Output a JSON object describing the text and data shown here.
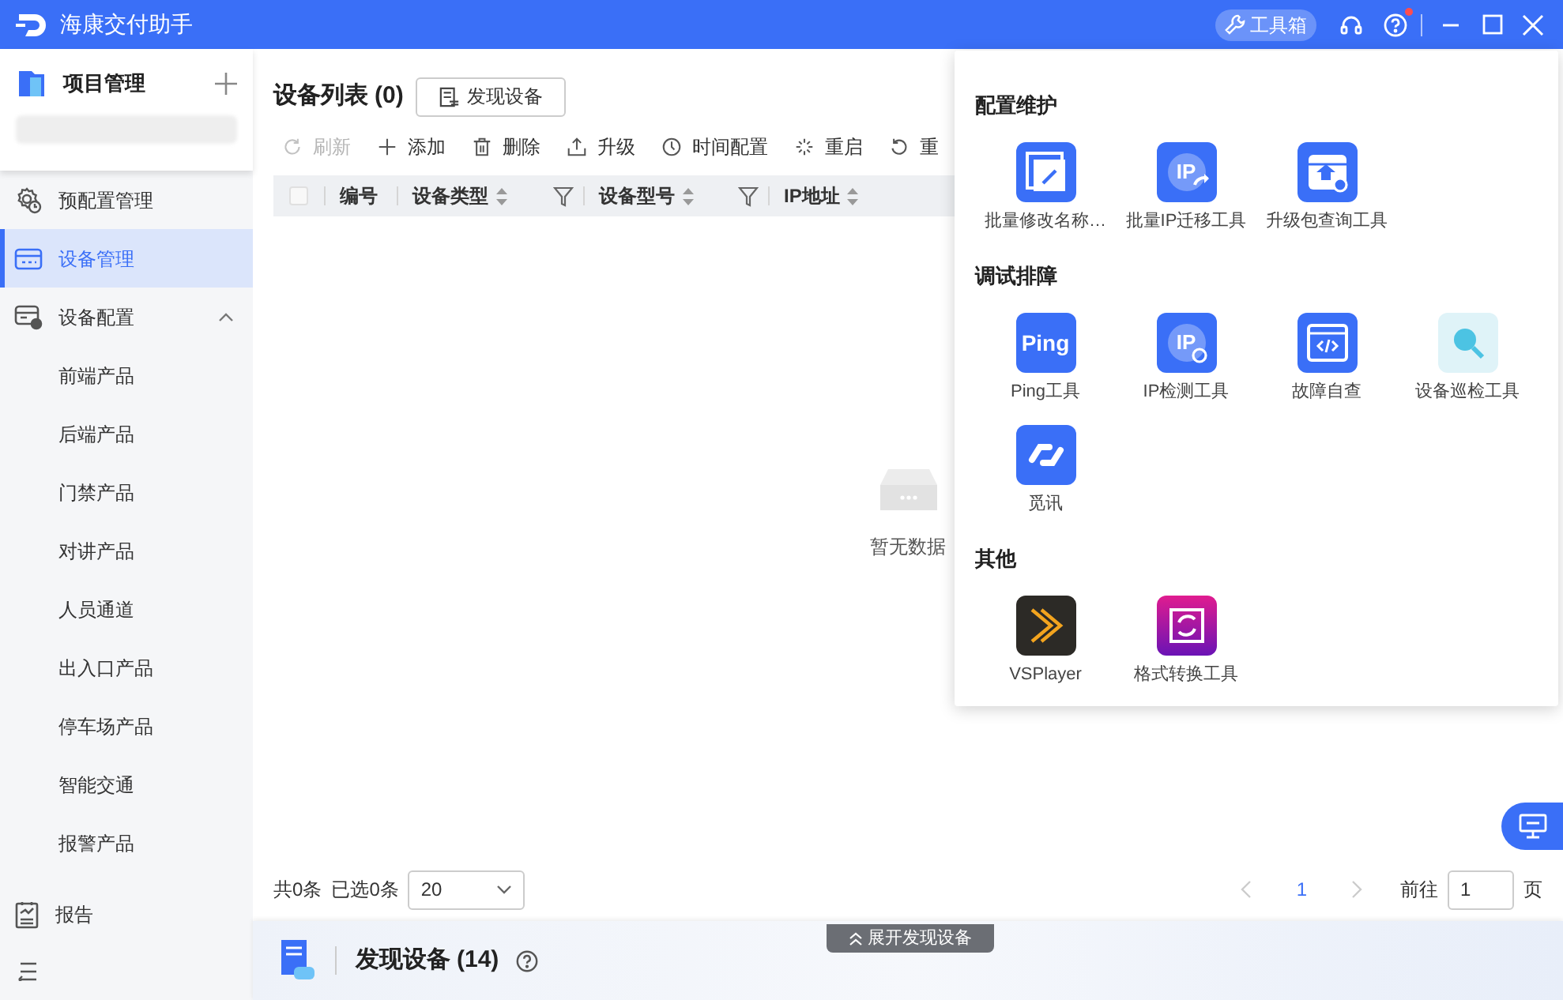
{
  "window": {
    "title": "海康交付助手"
  },
  "title_bar": {
    "toolbox_button": {
      "label": "工具箱",
      "selected": true
    },
    "help_unread": true
  },
  "sidebar": {
    "project": {
      "title": "项目管理"
    },
    "items": [
      {
        "label": "预配置管理",
        "kind": "preconfig",
        "selected": false
      },
      {
        "label": "设备管理",
        "kind": "device",
        "selected": true
      },
      {
        "label": "设备配置",
        "kind": "config",
        "selected": false,
        "expanded": true,
        "children": [
          {
            "label": "前端产品",
            "selected": false
          },
          {
            "label": "后端产品",
            "selected": false
          },
          {
            "label": "门禁产品",
            "selected": false
          },
          {
            "label": "对讲产品",
            "selected": false
          },
          {
            "label": "人员通道",
            "selected": false
          },
          {
            "label": "出入口产品",
            "selected": false
          },
          {
            "label": "停车场产品",
            "selected": false
          },
          {
            "label": "智能交通",
            "selected": false
          },
          {
            "label": "报警产品",
            "selected": false
          }
        ]
      },
      {
        "label": "报告",
        "kind": "report",
        "selected": false
      }
    ]
  },
  "main": {
    "title": "设备列表",
    "count": "(0)",
    "discover_button": "发现设备",
    "toolbar": [
      {
        "label": "刷新",
        "kind": "refresh",
        "disabled": true
      },
      {
        "label": "添加",
        "kind": "add",
        "disabled": false
      },
      {
        "label": "删除",
        "kind": "delete",
        "disabled": false
      },
      {
        "label": "升级",
        "kind": "upgrade",
        "disabled": false
      },
      {
        "label": "时间配置",
        "kind": "clock",
        "disabled": false
      },
      {
        "label": "重启",
        "kind": "reboot",
        "disabled": false
      },
      {
        "label": "重",
        "kind": "restore",
        "disabled": false
      }
    ],
    "table": {
      "select_all": {
        "checked": false
      },
      "columns": [
        {
          "label": "编号"
        },
        {
          "label": "设备类型",
          "sortable": true,
          "filterable": true
        },
        {
          "label": "设备型号",
          "sortable": true,
          "filterable": true
        },
        {
          "label": "IP地址",
          "sortable": true
        }
      ],
      "empty_text": "暂无数据"
    },
    "pagination": {
      "total": "共0条",
      "selected_count": "已选0条",
      "page_size": "20",
      "pages": [
        {
          "label": "1",
          "selected": true
        }
      ],
      "goto_label": "前往",
      "goto_value": "1",
      "page_suffix": "页"
    },
    "discover_panel": {
      "expand_tab": "展开发现设备",
      "title": "发现设备",
      "count": "(14)"
    }
  },
  "toolbox": {
    "sections": [
      {
        "title": "配置维护",
        "tools": [
          {
            "label": "批量修改名称…",
            "kind": "rename"
          },
          {
            "label": "批量IP迁移工具",
            "kind": "ip_migrate",
            "icon_text": "IP"
          },
          {
            "label": "升级包查询工具",
            "kind": "package"
          }
        ]
      },
      {
        "title": "调试排障",
        "tools": [
          {
            "label": "Ping工具",
            "kind": "ping",
            "icon_text": "Ping"
          },
          {
            "label": "IP检测工具",
            "kind": "ip_check",
            "icon_text": "IP"
          },
          {
            "label": "故障自查",
            "kind": "code"
          },
          {
            "label": "设备巡检工具",
            "kind": "inspect"
          },
          {
            "label": "觅讯",
            "kind": "link"
          }
        ]
      },
      {
        "title": "其他",
        "tools": [
          {
            "label": "VSPlayer",
            "kind": "player"
          },
          {
            "label": "格式转换工具",
            "kind": "convert"
          }
        ]
      }
    ]
  }
}
